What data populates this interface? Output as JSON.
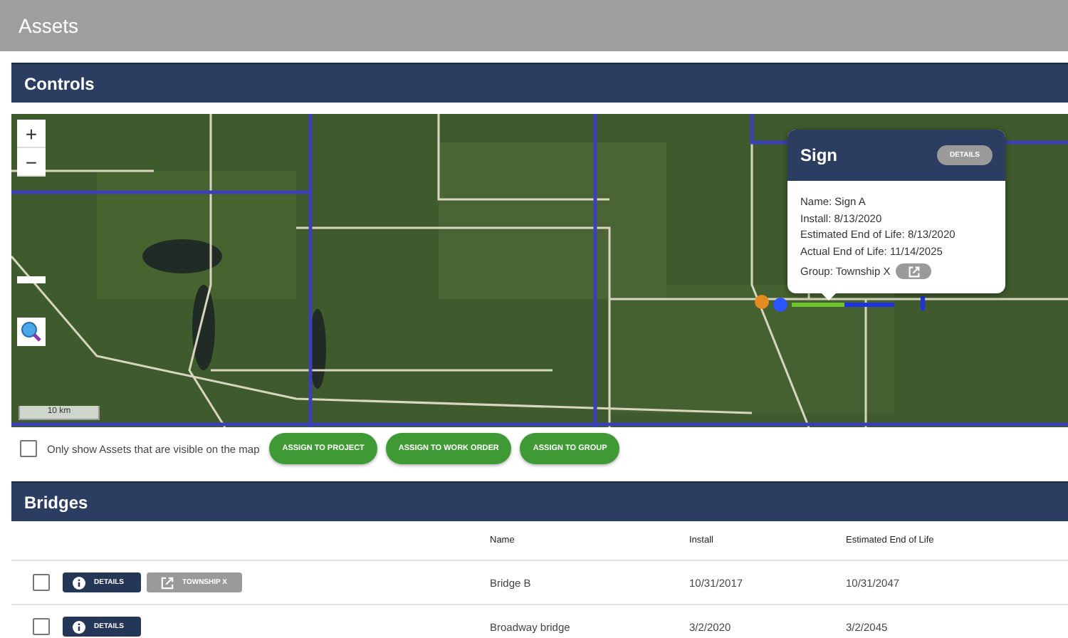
{
  "app_bar": {
    "title": "Assets"
  },
  "controls": {
    "title": "Controls",
    "map": {
      "zoom_in": "+",
      "zoom_out": "−",
      "scale": "10 km",
      "popup": {
        "title": "Sign",
        "details_button": "DETAILS",
        "fields": [
          "Name: Sign A",
          "Install: 8/13/2020",
          "Estimated End of Life: 8/13/2020",
          "Actual End of Life: 11/14/2025"
        ],
        "group": "Group: Township X"
      }
    },
    "filter": {
      "label": "Only show Assets that are visible on the map",
      "checked": false
    },
    "buttons": [
      "ASSIGN TO PROJECT",
      "ASSIGN TO WORK ORDER",
      "ASSIGN TO GROUP"
    ]
  },
  "bridges": {
    "title": "Bridges",
    "columns": [
      "Name",
      "Install",
      "Estimated End of Life"
    ],
    "rows": [
      {
        "checked": false,
        "details": "DETAILS",
        "group": "TOWNSHIP X",
        "name": "Bridge B",
        "install": "10/31/2017",
        "end_of_life": "10/31/2047"
      },
      {
        "checked": false,
        "details": "DETAILS",
        "name": "Broadway bridge",
        "install": "3/2/2020",
        "end_of_life": "3/2/2045"
      }
    ]
  }
}
